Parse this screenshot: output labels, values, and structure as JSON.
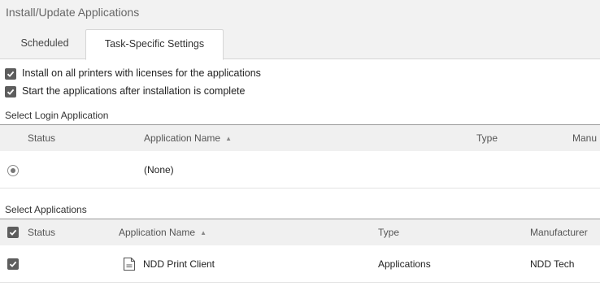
{
  "window": {
    "title": "Install/Update Applications"
  },
  "tabs": [
    {
      "label": "Scheduled",
      "active": false
    },
    {
      "label": "Task-Specific Settings",
      "active": true
    }
  ],
  "options": [
    {
      "label": "Install on all printers with licenses for the applications",
      "checked": true
    },
    {
      "label": "Start the applications after installation is complete",
      "checked": true
    }
  ],
  "login_section": {
    "label": "Select Login Application",
    "columns": {
      "status": "Status",
      "name": "Application Name",
      "type": "Type",
      "manufacturer": "Manu"
    },
    "rows": [
      {
        "status": "selected-radio",
        "name": "(None)",
        "type": "",
        "manufacturer": ""
      }
    ]
  },
  "apps_section": {
    "label": "Select Applications",
    "header_checked": true,
    "columns": {
      "status": "Status",
      "name": "Application Name",
      "type": "Type",
      "manufacturer": "Manufacturer"
    },
    "rows": [
      {
        "checked": true,
        "icon": "document-icon",
        "name": "NDD Print Client",
        "type": "Applications",
        "manufacturer": "NDD Tech"
      }
    ]
  },
  "sort_icon": "sort-ascending-icon",
  "colors": {
    "checkbox": "#5d5d5d",
    "header_bg": "#f0f0f0",
    "title_bar_bg": "#f2f2f2"
  }
}
